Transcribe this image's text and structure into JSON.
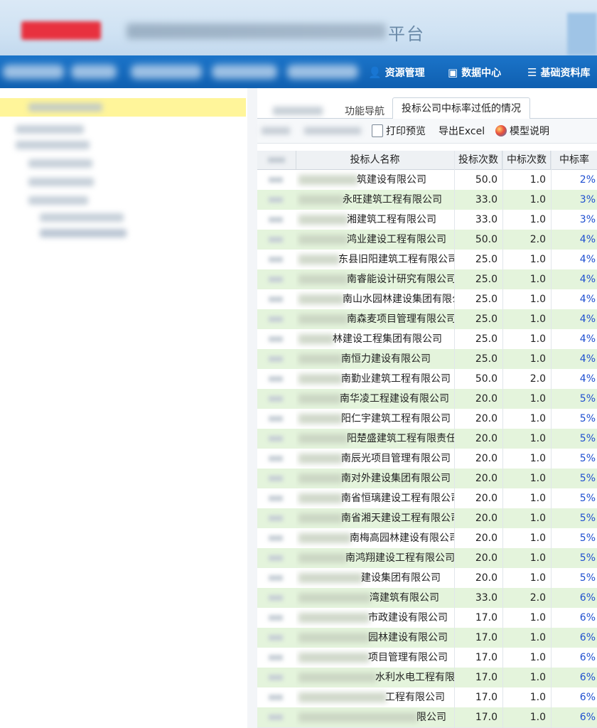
{
  "header": {
    "title_visible_part": "平台",
    "colors": {
      "header_bg": "#cfe2f3",
      "nav_bg": "#1468bd",
      "logo_red": "#e8313f"
    }
  },
  "nav": {
    "items": [
      {
        "icon": "user-icon",
        "label": "资源管理"
      },
      {
        "icon": "chart-icon",
        "label": "数据中心"
      },
      {
        "icon": "list-icon",
        "label": "基础资料库"
      }
    ]
  },
  "tabs": {
    "nav_label": "功能导航",
    "active_label": "投标公司中标率过低的情况"
  },
  "toolbar": {
    "print_label": "打印预览",
    "export_label": "导出Excel",
    "model_label": "模型说明"
  },
  "grid": {
    "columns": [
      "投标人名称",
      "投标次数",
      "中标次数",
      "中标率"
    ],
    "rows": [
      {
        "name": "筑建设有限公司",
        "bid": "50.0",
        "win": "1.0",
        "rate": "2%"
      },
      {
        "name": "永旺建筑工程有限公司",
        "bid": "33.0",
        "win": "1.0",
        "rate": "3%"
      },
      {
        "name": "湘建筑工程有限公司",
        "bid": "33.0",
        "win": "1.0",
        "rate": "3%"
      },
      {
        "name": "鸿业建设工程有限公司",
        "bid": "50.0",
        "win": "2.0",
        "rate": "4%"
      },
      {
        "name": "东县旧阳建筑工程有限公司",
        "bid": "25.0",
        "win": "1.0",
        "rate": "4%"
      },
      {
        "name": "南睿能设计研究有限公司",
        "bid": "25.0",
        "win": "1.0",
        "rate": "4%"
      },
      {
        "name": "南山水园林建设集团有限公司",
        "bid": "25.0",
        "win": "1.0",
        "rate": "4%"
      },
      {
        "name": "南森麦项目管理有限公司",
        "bid": "25.0",
        "win": "1.0",
        "rate": "4%"
      },
      {
        "name": "林建设工程集团有限公司",
        "bid": "25.0",
        "win": "1.0",
        "rate": "4%"
      },
      {
        "name": "南恒力建设有限公司",
        "bid": "25.0",
        "win": "1.0",
        "rate": "4%"
      },
      {
        "name": "南勤业建筑工程有限公司",
        "bid": "50.0",
        "win": "2.0",
        "rate": "4%"
      },
      {
        "name": "南华凌工程建设有限公司",
        "bid": "20.0",
        "win": "1.0",
        "rate": "5%"
      },
      {
        "name": "阳仁宇建筑工程有限公司",
        "bid": "20.0",
        "win": "1.0",
        "rate": "5%"
      },
      {
        "name": "阳楚盛建筑工程有限责任公司",
        "bid": "20.0",
        "win": "1.0",
        "rate": "5%"
      },
      {
        "name": "南辰光项目管理有限公司",
        "bid": "20.0",
        "win": "1.0",
        "rate": "5%"
      },
      {
        "name": "南对外建设集团有限公司",
        "bid": "20.0",
        "win": "1.0",
        "rate": "5%"
      },
      {
        "name": "南省恒璃建设工程有限公司",
        "bid": "20.0",
        "win": "1.0",
        "rate": "5%"
      },
      {
        "name": "南省湘天建设工程有限公司",
        "bid": "20.0",
        "win": "1.0",
        "rate": "5%"
      },
      {
        "name": "南梅高园林建设有限公司",
        "bid": "20.0",
        "win": "1.0",
        "rate": "5%"
      },
      {
        "name": "南鸿翔建设工程有限公司",
        "bid": "20.0",
        "win": "1.0",
        "rate": "5%"
      },
      {
        "name": "建设集团有限公司",
        "bid": "20.0",
        "win": "1.0",
        "rate": "5%"
      },
      {
        "name": "湾建筑有限公司",
        "bid": "33.0",
        "win": "2.0",
        "rate": "6%"
      },
      {
        "name": "市政建设有限公司",
        "bid": "17.0",
        "win": "1.0",
        "rate": "6%"
      },
      {
        "name": "园林建设有限公司",
        "bid": "17.0",
        "win": "1.0",
        "rate": "6%"
      },
      {
        "name": "项目管理有限公司",
        "bid": "17.0",
        "win": "1.0",
        "rate": "6%"
      },
      {
        "name": "水利水电工程有限公司",
        "bid": "17.0",
        "win": "1.0",
        "rate": "6%"
      },
      {
        "name": "工程有限公司",
        "bid": "17.0",
        "win": "1.0",
        "rate": "6%"
      },
      {
        "name": "限公司",
        "bid": "17.0",
        "win": "1.0",
        "rate": "6%"
      }
    ]
  }
}
